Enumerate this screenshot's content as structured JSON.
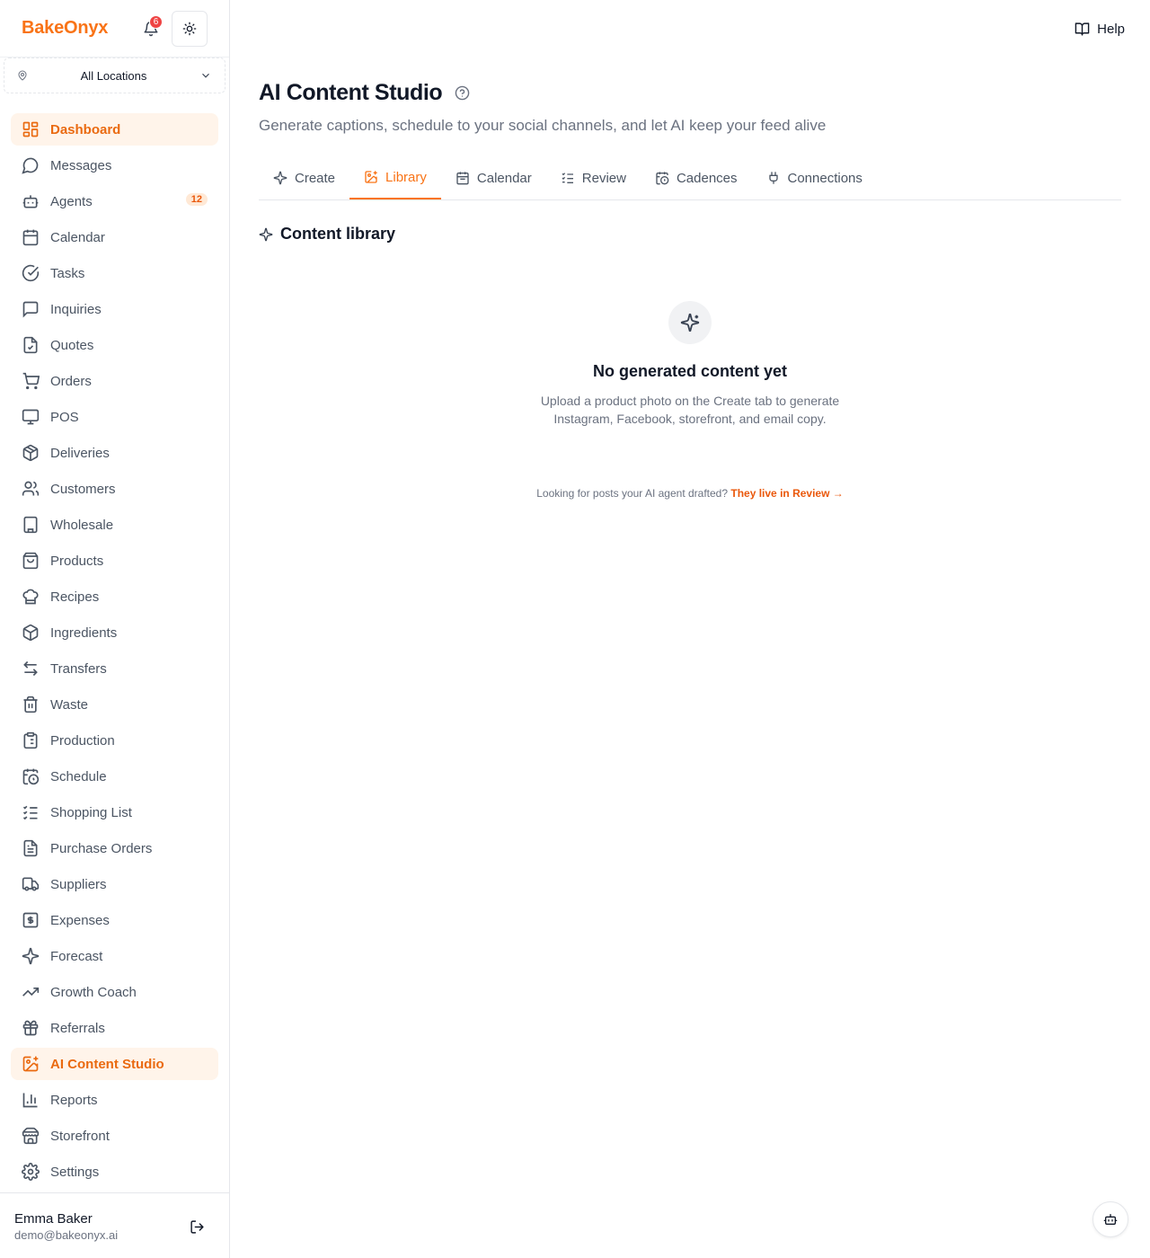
{
  "brand": "BakeOnyx",
  "notifications": {
    "count": "6",
    "icon": "bell-icon"
  },
  "location": {
    "selected": "All Locations"
  },
  "sidebar": {
    "items": [
      {
        "label": "Dashboard",
        "icon": "dashboard-icon",
        "active": true
      },
      {
        "label": "Messages",
        "icon": "message-icon"
      },
      {
        "label": "Agents",
        "icon": "bot-icon",
        "count": "12"
      },
      {
        "label": "Calendar",
        "icon": "calendar-icon"
      },
      {
        "label": "Tasks",
        "icon": "check-circle-icon"
      },
      {
        "label": "Inquiries",
        "icon": "chat-square-icon"
      },
      {
        "label": "Quotes",
        "icon": "file-check-icon"
      },
      {
        "label": "Orders",
        "icon": "cart-icon"
      },
      {
        "label": "POS",
        "icon": "monitor-icon"
      },
      {
        "label": "Deliveries",
        "icon": "package-icon"
      },
      {
        "label": "Customers",
        "icon": "users-icon"
      },
      {
        "label": "Wholesale",
        "icon": "building-icon"
      },
      {
        "label": "Products",
        "icon": "shopping-bag-icon"
      },
      {
        "label": "Recipes",
        "icon": "chef-hat-icon"
      },
      {
        "label": "Ingredients",
        "icon": "box-icon"
      },
      {
        "label": "Transfers",
        "icon": "transfer-icon"
      },
      {
        "label": "Waste",
        "icon": "trash-icon"
      },
      {
        "label": "Production",
        "icon": "clipboard-icon"
      },
      {
        "label": "Schedule",
        "icon": "calendar-clock-icon"
      },
      {
        "label": "Shopping List",
        "icon": "list-check-icon"
      },
      {
        "label": "Purchase Orders",
        "icon": "file-text-icon"
      },
      {
        "label": "Suppliers",
        "icon": "truck-icon"
      },
      {
        "label": "Expenses",
        "icon": "dollar-square-icon"
      },
      {
        "label": "Forecast",
        "icon": "sparkles-icon"
      },
      {
        "label": "Growth Coach",
        "icon": "trending-up-icon"
      },
      {
        "label": "Referrals",
        "icon": "gift-icon"
      },
      {
        "label": "AI Content Studio",
        "icon": "image-plus-icon",
        "active": true
      },
      {
        "label": "Reports",
        "icon": "bar-chart-icon"
      },
      {
        "label": "Storefront",
        "icon": "store-icon"
      },
      {
        "label": "Settings",
        "icon": "gear-icon"
      }
    ]
  },
  "user": {
    "name": "Emma Baker",
    "email": "demo@bakeonyx.ai"
  },
  "header": {
    "help_label": "Help"
  },
  "page": {
    "title": "AI Content Studio",
    "subtitle": "Generate captions, schedule to your social channels, and let AI keep your feed alive"
  },
  "tabs": [
    {
      "label": "Create",
      "icon": "sparkles-icon"
    },
    {
      "label": "Library",
      "icon": "image-plus-icon",
      "active": true
    },
    {
      "label": "Calendar",
      "icon": "calendar-icon"
    },
    {
      "label": "Review",
      "icon": "list-check-icon"
    },
    {
      "label": "Cadences",
      "icon": "calendar-clock-icon"
    },
    {
      "label": "Connections",
      "icon": "plug-icon"
    }
  ],
  "library": {
    "title": "Content library",
    "empty_title": "No generated content yet",
    "empty_desc_line1": "Upload a product photo on the Create tab to generate",
    "empty_desc_line2": "Instagram, Facebook, storefront, and email copy.",
    "hint_text": "Looking for posts your AI agent drafted?",
    "hint_link": "They live in Review →"
  },
  "colors": {
    "accent": "#f97316",
    "active_bg": "#fff4ea",
    "badge_red": "#ef4444"
  }
}
